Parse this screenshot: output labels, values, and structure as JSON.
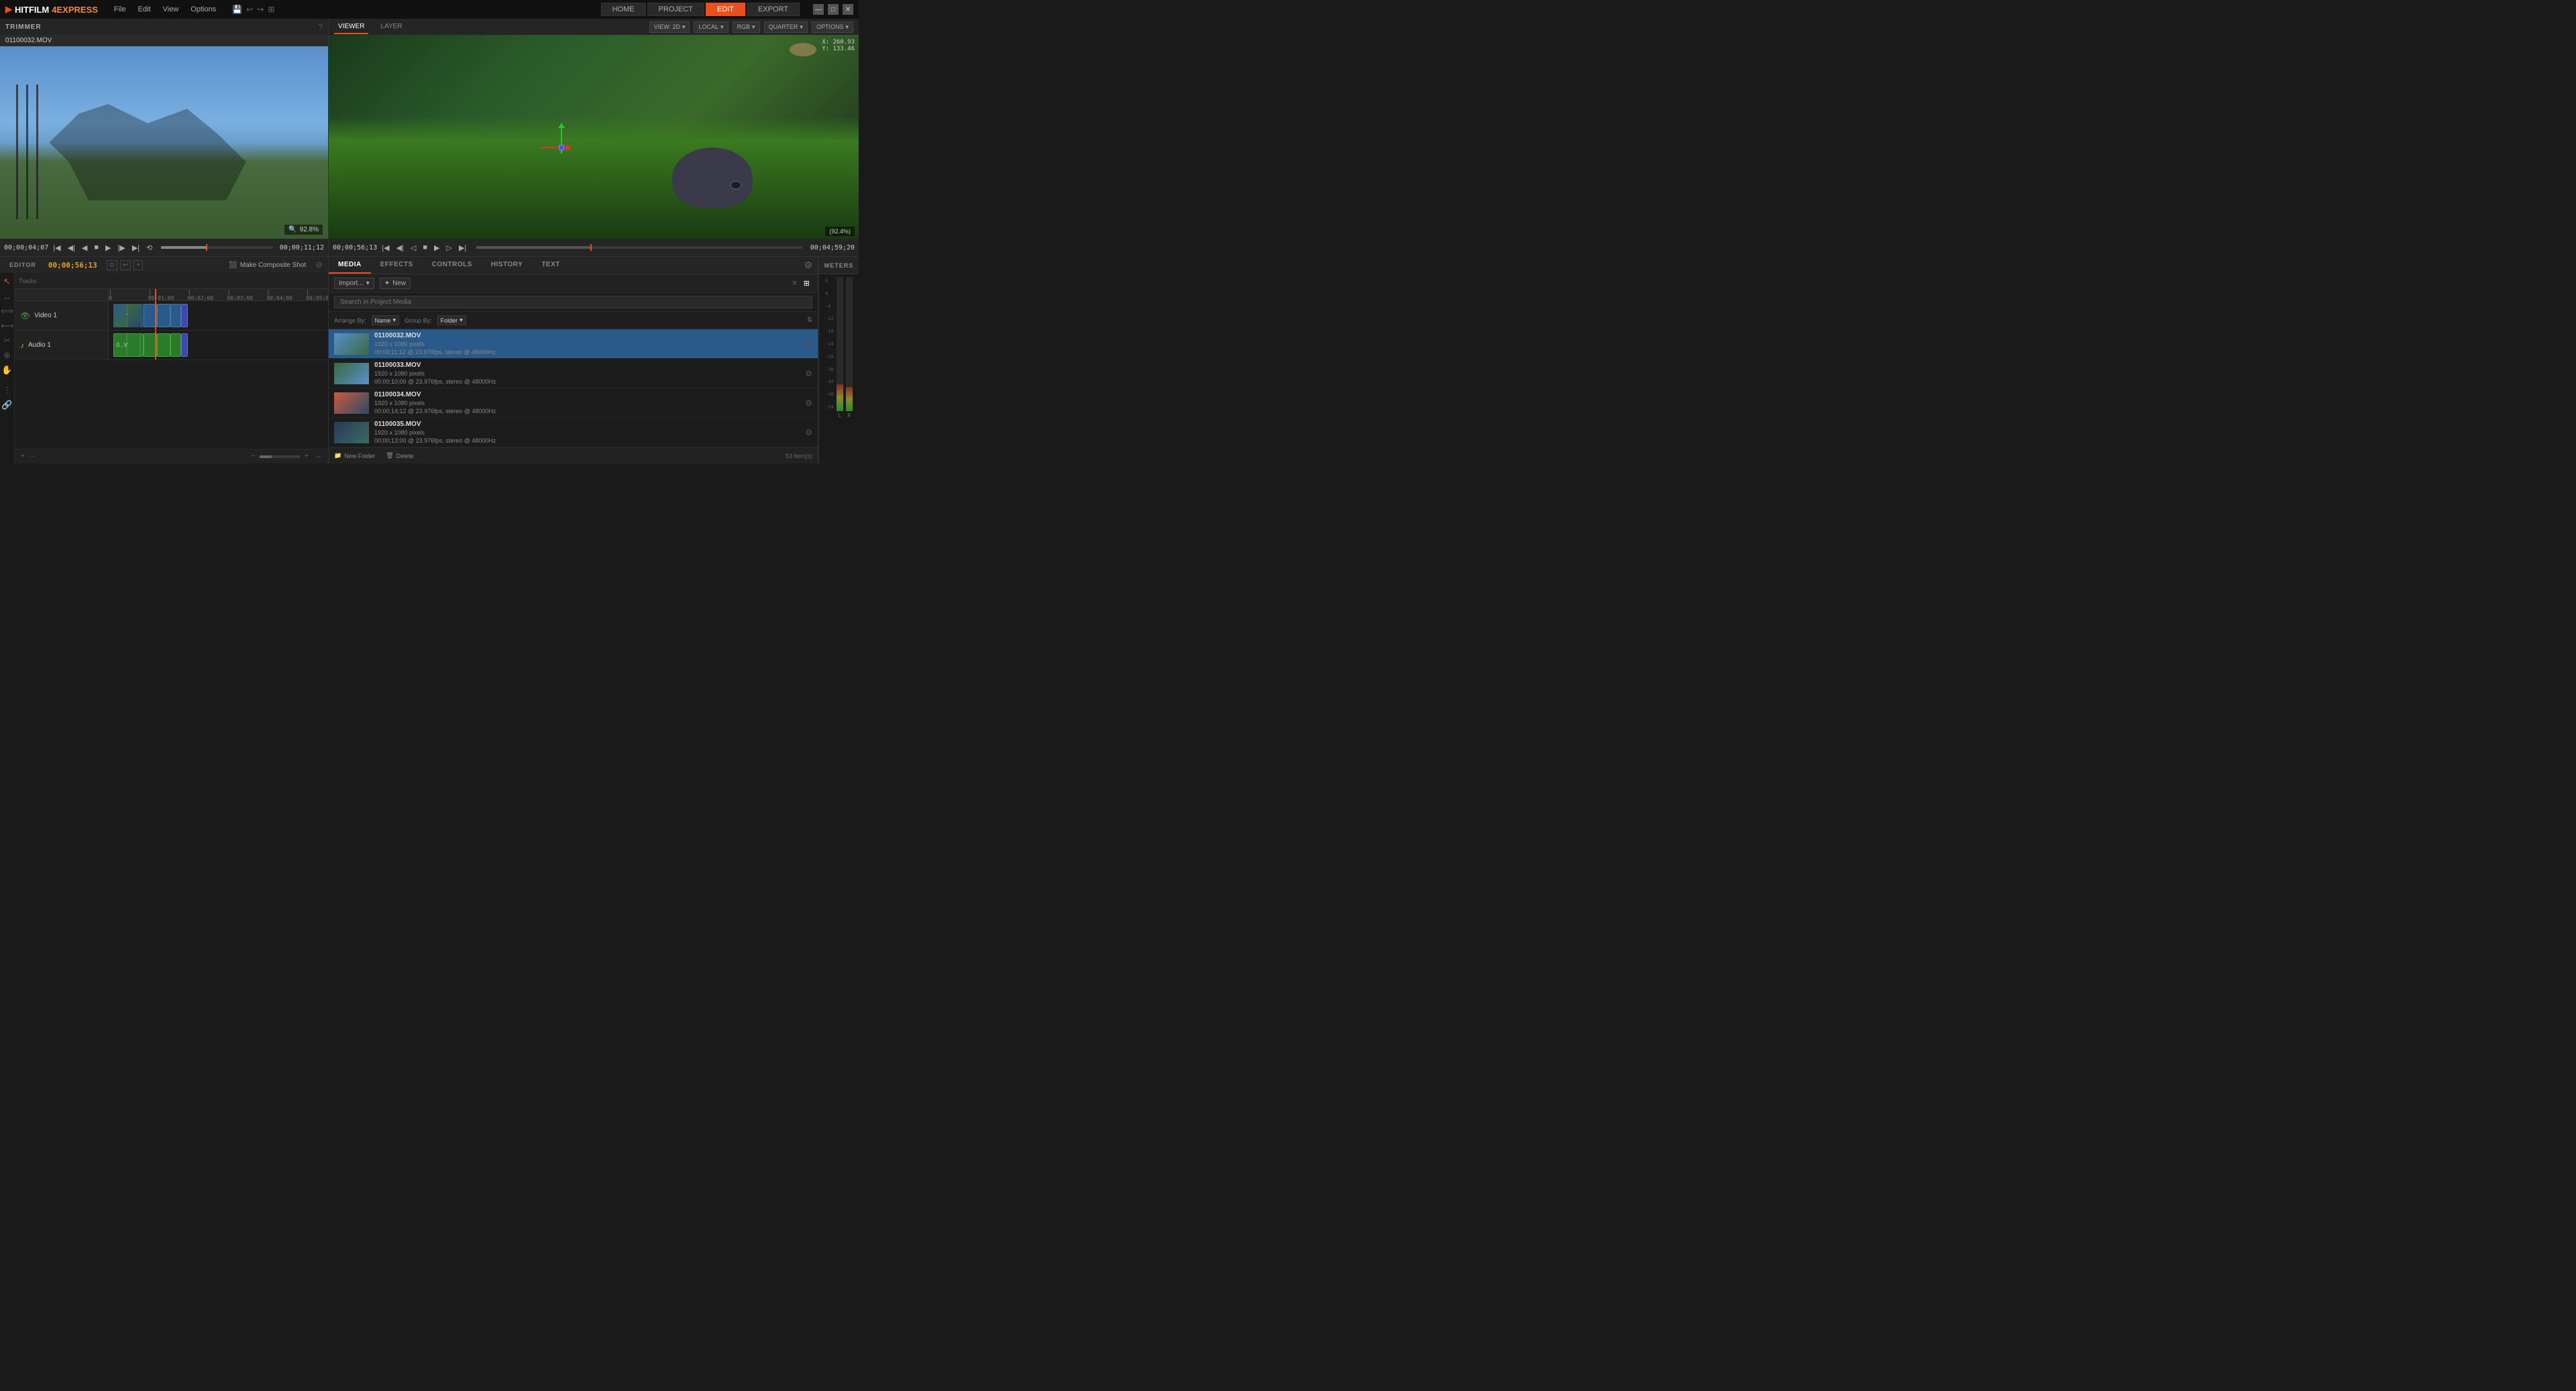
{
  "app": {
    "name": "HITFILM",
    "name2": "4EXPRESS",
    "title_menus": [
      "File",
      "Edit",
      "View",
      "Options"
    ],
    "nav_buttons": [
      "HOME",
      "PROJECT",
      "EDIT",
      "EXPORT"
    ],
    "active_nav": "EDIT"
  },
  "trimmer": {
    "panel_title": "TRIMMER",
    "filename": "01100032.MOV",
    "timecode_left": "00;00;04;07",
    "timecode_right": "00;00;11;12",
    "zoom": "92.8%"
  },
  "viewer": {
    "tabs": [
      "VIEWER",
      "LAYER"
    ],
    "active_tab": "VIEWER",
    "view_mode": "VIEW: 2D",
    "local_mode": "LOCAL",
    "color_mode": "RGB",
    "quality": "QUARTER",
    "options": "OPTIONS",
    "coords": "X: 260.93\nY: 133.46",
    "zoom": "(92.4%)",
    "timecode_left": "00;00;56;13",
    "timecode_right": "00;04;59;20"
  },
  "editor": {
    "panel_title": "EDITOR",
    "timecode": "00;00;56;13",
    "make_composite": "Make Composite Shot",
    "tracks": [
      {
        "name": "Video 1",
        "type": "video",
        "icon": "▶"
      },
      {
        "name": "Audio 1",
        "type": "audio",
        "icon": "♪"
      }
    ],
    "ruler_marks": [
      "0",
      "00;00;01;00",
      "00;02;00;02",
      "00;03;00;03",
      "00;04;00;04",
      "00;05;0"
    ]
  },
  "media": {
    "tabs": [
      "MEDIA",
      "EFFECTS",
      "CONTROLS",
      "HISTORY",
      "TEXT"
    ],
    "active_tab": "MEDIA",
    "search_placeholder": "Search in Project Media",
    "arrange_label": "Arrange By:",
    "arrange_value": "Name",
    "group_label": "Group By:",
    "group_value": "Folder",
    "import_label": "Import...",
    "new_label": "New",
    "items": [
      {
        "name": "01100032.MOV",
        "meta1": "1920 x 1080 pixels",
        "meta2": "00;00;11;12 @ 23.976fps, stereo @ 48000Hz",
        "selected": true
      },
      {
        "name": "01100033.MOV",
        "meta1": "1920 x 1080 pixels",
        "meta2": "00;00;10;00 @ 23.976fps, stereo @ 48000Hz",
        "selected": false
      },
      {
        "name": "01100034.MOV",
        "meta1": "1920 x 1080 pixels",
        "meta2": "00;00;14;12 @ 23.976fps, stereo @ 48000Hz",
        "selected": false
      },
      {
        "name": "01100035.MOV",
        "meta1": "1920 x 1080 pixels",
        "meta2": "00;00;13;00 @ 23.976fps, stereo @ 48000Hz",
        "selected": false
      }
    ],
    "footer": {
      "new_folder": "New Folder",
      "delete": "Delete",
      "item_count": "53 item(s)"
    }
  },
  "meters": {
    "title": "METERS",
    "labels": [
      "6",
      "0",
      "-6",
      "-12",
      "-18",
      "-24",
      "-30",
      "-36",
      "-42",
      "-48",
      "-54"
    ]
  },
  "controls_tab": {
    "label": "CONTROLS"
  },
  "new_button": {
    "label": "New"
  }
}
